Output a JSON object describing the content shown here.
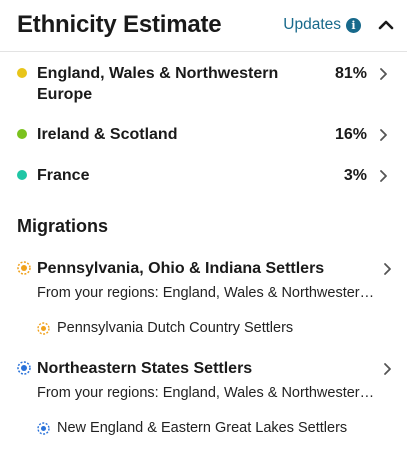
{
  "header": {
    "title": "Ethnicity Estimate",
    "updates_label": "Updates",
    "info_icon": "info-icon",
    "collapse_icon": "chevron-up-icon"
  },
  "ethnicities": [
    {
      "name": "England, Wales & Northwestern Europe",
      "percent": "81%",
      "color": "#e8c51a"
    },
    {
      "name": "Ireland & Scotland",
      "percent": "16%",
      "color": "#7bc21e"
    },
    {
      "name": "France",
      "percent": "3%",
      "color": "#1fc6a5"
    }
  ],
  "migrations": {
    "title": "Migrations",
    "items": [
      {
        "name": "Pennsylvania, Ohio & Indiana Settlers",
        "subtitle": "From your regions: England, Wales & Northwestern Europe",
        "color": "#f0a11c",
        "sub_community": "Pennsylvania Dutch Country Settlers"
      },
      {
        "name": "Northeastern States Settlers",
        "subtitle": "From your regions: England, Wales & Northwestern Europe",
        "color": "#2a72d9",
        "sub_community": "New England & Eastern Great Lakes Settlers"
      }
    ]
  }
}
